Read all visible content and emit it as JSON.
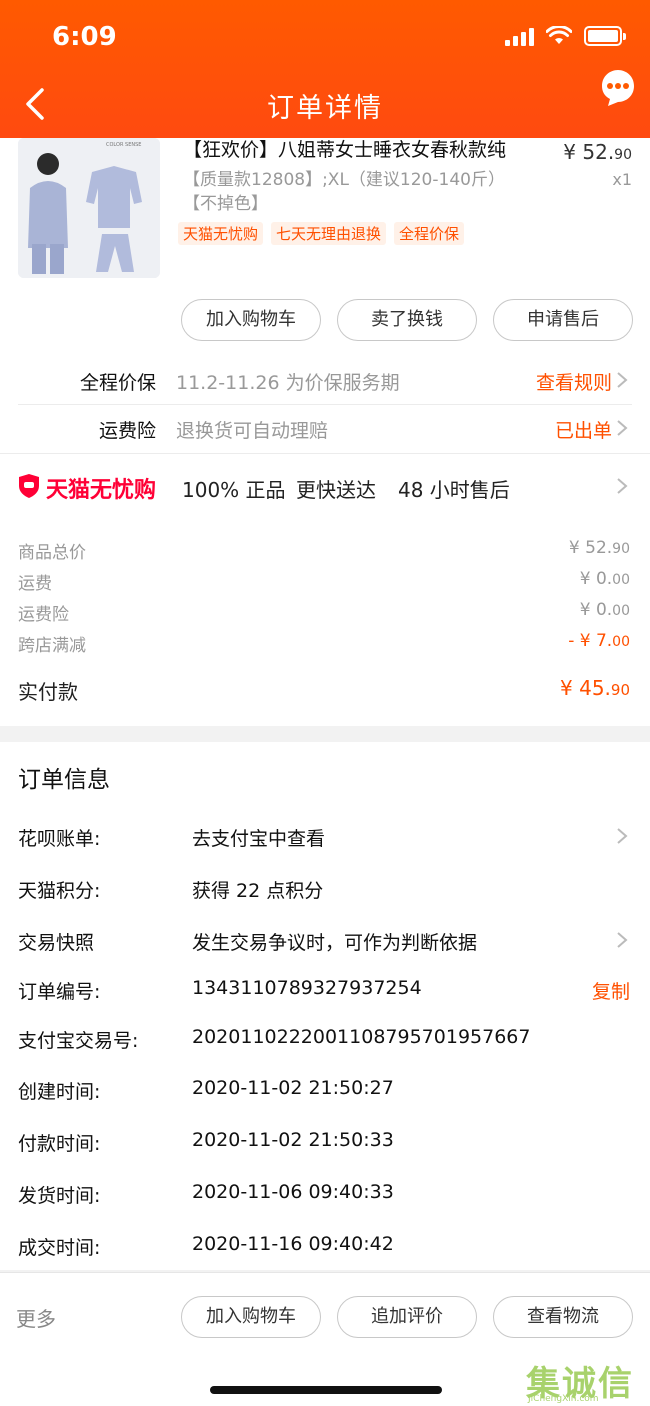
{
  "status_bar": {
    "time": "6:09"
  },
  "header": {
    "title": "订单详情"
  },
  "product": {
    "title": "【狂欢价】八姐蒂女士睡衣女春秋款纯",
    "price_int": "¥ 52.",
    "price_dec": "90",
    "spec_line1": "【质量款12808】;XL（建议120-140斤）",
    "spec_line2": "【不掉色】",
    "qty": "x1",
    "tags": [
      "天猫无忧购",
      "七天无理由退换",
      "全程价保"
    ],
    "thumb_brand": "COLOR SENSE",
    "buttons": [
      "加入购物车",
      "卖了换钱",
      "申请售后"
    ]
  },
  "services": [
    {
      "label": "全程价保",
      "desc": "11.2-11.26 为价保服务期",
      "action": "查看规则"
    },
    {
      "label": "运费险",
      "desc": "退换货可自动理赔",
      "action": "已出单"
    }
  ],
  "guarantee": {
    "brand": "天猫无忧购",
    "features": [
      "100% 正品",
      "更快送达",
      "48 小时售后"
    ]
  },
  "summary": {
    "rows": [
      {
        "label": "商品总价",
        "value": "¥ 52.",
        "dec": "90"
      },
      {
        "label": "运费",
        "value": "¥ 0.",
        "dec": "00"
      },
      {
        "label": "运费险",
        "value": "¥ 0.",
        "dec": "00"
      },
      {
        "label": "跨店满减",
        "value": "- ¥ 7.",
        "dec": "00"
      }
    ],
    "paid_label": "实付款",
    "paid_value": "¥ 45.",
    "paid_dec": "90"
  },
  "order_info": {
    "title": "订单信息",
    "rows": [
      {
        "key": "花呗账单:",
        "value": "去支付宝中查看"
      },
      {
        "key": "天猫积分:",
        "value": "获得 22 点积分"
      },
      {
        "key": "交易快照",
        "value": "发生交易争议时，可作为判断依据"
      },
      {
        "key": "订单编号:",
        "value": "1343110789327937254",
        "action": "复制"
      },
      {
        "key": "支付宝交易号:",
        "value": "2020110222001108795701957667"
      },
      {
        "key": "创建时间:",
        "value": "2020-11-02 21:50:27"
      },
      {
        "key": "付款时间:",
        "value": "2020-11-02 21:50:33"
      },
      {
        "key": "发货时间:",
        "value": "2020-11-06 09:40:33"
      },
      {
        "key": "成交时间:",
        "value": "2020-11-16 09:40:42"
      }
    ]
  },
  "bottom_bar": {
    "more": "更多",
    "buttons": [
      "加入购物车",
      "追加评价",
      "查看物流"
    ]
  },
  "watermark": {
    "glyphs": "集诚信",
    "url": "JiChengXin.com"
  },
  "colors": {
    "accent": "#ff5000",
    "tmall_red": "#ff0036",
    "header": "#ff5a00"
  }
}
